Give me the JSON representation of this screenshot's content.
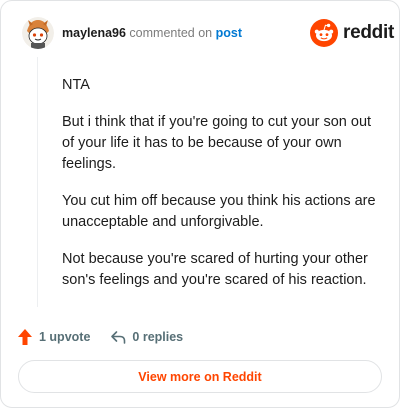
{
  "comment": {
    "username": "maylena96",
    "commented_text": "commented on",
    "post_link": "post",
    "paragraphs": [
      "NTA",
      "But i think that if you're going to cut your son out of your life it has to be because of your own feelings.",
      "You cut him off because you think his actions are unacceptable and unforgivable.",
      "Not because you're scared of hurting your other son's feelings and you're scared of his reaction."
    ]
  },
  "brand": {
    "wordmark": "reddit",
    "color": "#ff4500"
  },
  "actions": {
    "upvote_label": "1 upvote",
    "replies_label": "0 replies"
  },
  "footer": {
    "view_more_label": "View more on Reddit"
  },
  "colors": {
    "accent": "#ff4500",
    "link": "#0079d3",
    "muted": "#576f76"
  }
}
